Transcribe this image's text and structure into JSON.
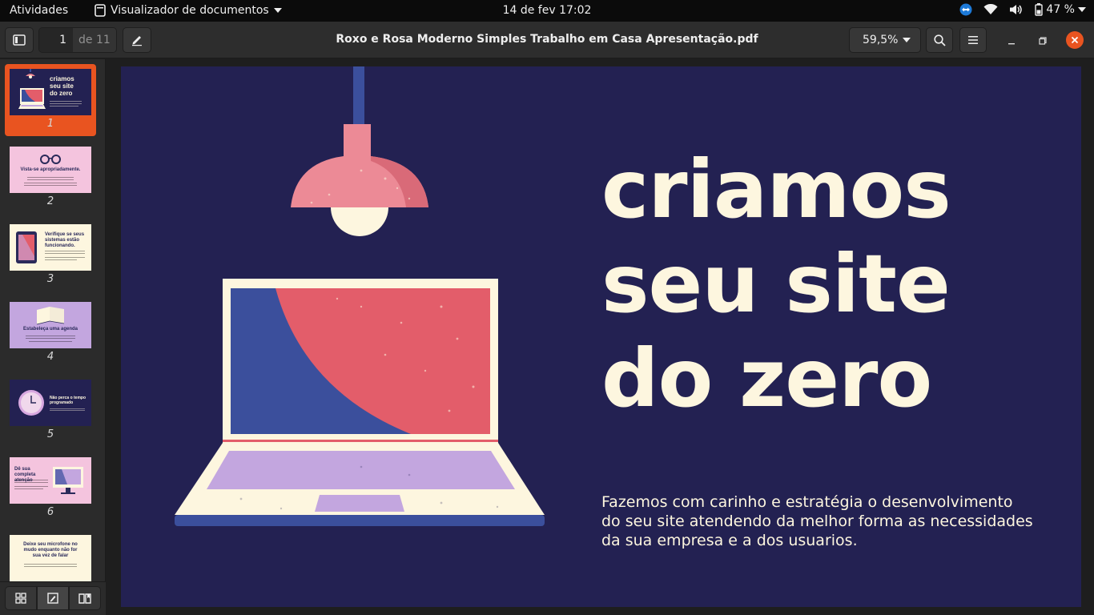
{
  "topbar": {
    "activities": "Atividades",
    "app_name": "Visualizador de documentos",
    "clock": "14 de fev  17:02",
    "battery": "47 %"
  },
  "header": {
    "page_number": "1",
    "page_of": "de 11",
    "title": "Roxo e Rosa Moderno Simples Trabalho em Casa Apresentação.pdf",
    "zoom": "59,5%"
  },
  "thumbnails": [
    {
      "num": "1",
      "title": "criamos seu site do zero"
    },
    {
      "num": "2",
      "title": "Vista-se apropriadamente."
    },
    {
      "num": "3",
      "title": "Verifique se seus sistemas estão funcionando."
    },
    {
      "num": "4",
      "title": "Estabeleça uma agenda"
    },
    {
      "num": "5",
      "title": "Não perca o tempo programado"
    },
    {
      "num": "6",
      "title": "Dê sua completa atenção"
    },
    {
      "num": "7",
      "title": "Deixe seu microfone no mudo enquanto não for sua vez de falar"
    }
  ],
  "slide": {
    "title_line1": "criamos",
    "title_line2": "seu site",
    "title_line3": "do zero",
    "body": "Fazemos com carinho e estratégia o desenvolvimento do seu site atendendo da melhor forma as necessidades da sua empresa e a dos usuarios."
  },
  "colors": {
    "slide_bg": "#232152",
    "cream": "#fdf6df",
    "pink": "#e35d6a",
    "blue": "#3b4f9c",
    "lavender": "#c3a6df",
    "accent": "#e95420"
  },
  "icons": [
    "sidebar-toggle-icon",
    "annotate-icon",
    "search-icon",
    "menu-icon",
    "minimize-icon",
    "maximize-icon",
    "close-icon",
    "thumbnails-icon",
    "annotations-icon",
    "bookmarks-icon",
    "teamviewer-icon",
    "wifi-icon",
    "volume-icon",
    "battery-icon"
  ]
}
